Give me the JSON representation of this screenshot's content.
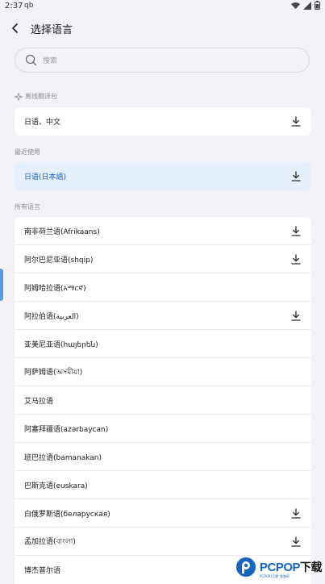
{
  "status": {
    "time": "2:37",
    "app_indicator": "qb"
  },
  "header": {
    "title": "选择语言"
  },
  "search": {
    "placeholder": "搜索"
  },
  "sections": {
    "offline": "离线翻译包",
    "recent": "最近使用",
    "all": "所有语言"
  },
  "offline_items": [
    {
      "label": "日语、中文",
      "download": true
    }
  ],
  "recent_items": [
    {
      "label": "日语(日本語)",
      "download": true,
      "selected": true
    }
  ],
  "all_items": [
    {
      "label": "南非荷兰语(Afrikaans)",
      "download": true
    },
    {
      "label": "阿尔巴尼亚语(shqip)",
      "download": true
    },
    {
      "label": "阿姆哈拉语(አማርኛ)",
      "download": false
    },
    {
      "label": "阿拉伯语(العربية)",
      "download": true
    },
    {
      "label": "亚美尼亚语(հայերեն)",
      "download": false
    },
    {
      "label": "阿萨姆语(অসমীয়া)",
      "download": false
    },
    {
      "label": "艾马拉语",
      "download": false
    },
    {
      "label": "阿塞拜疆语(azərbaycan)",
      "download": false
    },
    {
      "label": "班巴拉语(bamanakan)",
      "download": false
    },
    {
      "label": "巴斯克语(euskara)",
      "download": false
    },
    {
      "label": "白俄罗斯语(беларуская)",
      "download": true
    },
    {
      "label": "孟加拉语(বাংলা)",
      "download": true
    },
    {
      "label": "博杰普尔语",
      "download": false
    }
  ],
  "watermark": {
    "brand": "PCPOP",
    "suffix": "下载",
    "sub": "PCPOP.COM 泡泡网"
  },
  "colors": {
    "accent": "#1f5fb8",
    "highlight_bg": "#e4effb",
    "background": "#f3f3f7"
  }
}
